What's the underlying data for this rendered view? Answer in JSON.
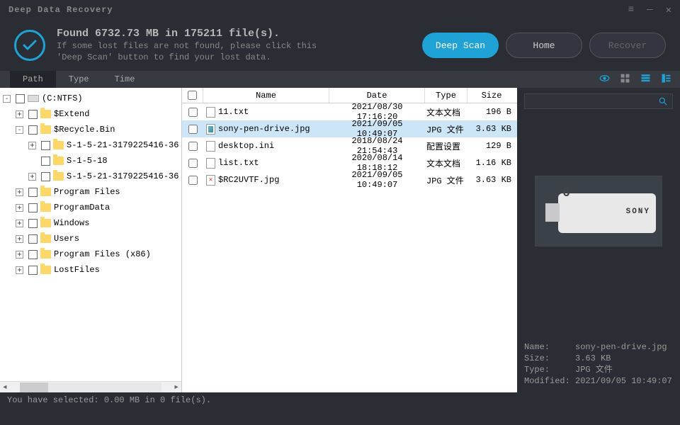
{
  "titlebar": {
    "title": "Deep Data Recovery"
  },
  "header": {
    "title": "Found 6732.73 MB in 175211 file(s).",
    "sub1": "If some lost files are not found, please click this",
    "sub2": "'Deep Scan' button to find your lost data.",
    "buttons": {
      "deepscan": "Deep Scan",
      "home": "Home",
      "recover": "Recover"
    }
  },
  "tabs": {
    "path": "Path",
    "type": "Type",
    "time": "Time"
  },
  "tree": {
    "root": "(C:NTFS)",
    "items": [
      "$Extend",
      "$Recycle.Bin",
      "S-1-5-21-3179225416-36",
      "S-1-5-18",
      "S-1-5-21-3179225416-36",
      "Program Files",
      "ProgramData",
      "Windows",
      "Users",
      "Program Files (x86)",
      "LostFiles"
    ]
  },
  "filelist": {
    "headers": {
      "name": "Name",
      "date": "Date",
      "type": "Type",
      "size": "Size"
    },
    "rows": [
      {
        "name": "11.txt",
        "date": "2021/08/30 17:16:20",
        "type": "文本文档",
        "size": "196  B",
        "icon": "txt"
      },
      {
        "name": "sony-pen-drive.jpg",
        "date": "2021/09/05 10:49:07",
        "type": "JPG 文件",
        "size": "3.63 KB",
        "icon": "img",
        "selected": true
      },
      {
        "name": "desktop.ini",
        "date": "2018/08/24 21:54:43",
        "type": "配置设置",
        "size": "129  B",
        "icon": "txt"
      },
      {
        "name": "list.txt",
        "date": "2020/08/14 18:18:12",
        "type": "文本文档",
        "size": "1.16 KB",
        "icon": "txt"
      },
      {
        "name": "$RC2UVTF.jpg",
        "date": "2021/09/05 10:49:07",
        "type": "JPG 文件",
        "size": "3.63 KB",
        "icon": "broken"
      }
    ]
  },
  "details": {
    "labels": {
      "name": "Name:",
      "size": "Size:",
      "type": "Type:",
      "modified": "Modified:"
    },
    "name": "sony-pen-drive.jpg",
    "size": "3.63 KB",
    "type": "JPG 文件",
    "modified": "2021/09/05 10:49:07"
  },
  "status": "You have selected: 0.00 MB in 0 file(s).",
  "preview": {
    "brand": "SONY",
    "capacity": "6"
  }
}
